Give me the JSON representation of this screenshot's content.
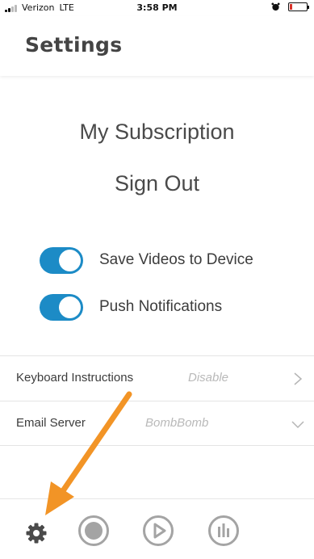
{
  "status_bar": {
    "carrier": "Verizon",
    "network": "LTE",
    "time": "3:58 PM"
  },
  "header": {
    "title": "Settings"
  },
  "links": {
    "subscription": "My Subscription",
    "sign_out": "Sign Out"
  },
  "toggles": [
    {
      "label": "Save Videos to Device",
      "on": true
    },
    {
      "label": "Push Notifications",
      "on": true
    }
  ],
  "rows": {
    "keyboard": {
      "label": "Keyboard Instructions",
      "value": "Disable"
    },
    "email": {
      "label": "Email Server",
      "value": "BombBomb"
    }
  },
  "tabs": [
    {
      "icon": "gear-icon"
    },
    {
      "icon": "record-icon"
    },
    {
      "icon": "play-icon"
    },
    {
      "icon": "stats-icon"
    }
  ],
  "colors": {
    "accent": "#1c8bc6",
    "tab_icon": "#a4a4a4",
    "annotation_arrow": "#f29426"
  },
  "battery_level": 0.15
}
